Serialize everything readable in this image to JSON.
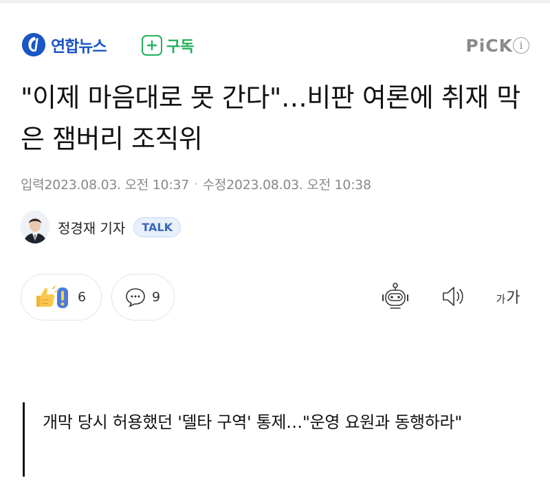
{
  "header": {
    "brand_name": "연합뉴스",
    "subscribe_label": "구독",
    "pick_label": "PiCK",
    "info_glyph": "i",
    "brand_color": "#1a56c4",
    "subscribe_color": "#1fb25a"
  },
  "article": {
    "headline": "\"이제 마음대로 못 간다\"…비판 여론에 취재 막은 잼버리 조직위",
    "input_label": "입력",
    "input_time": "2023.08.03. 오전 10:37",
    "edit_label": "수정",
    "edit_time": "2023.08.03. 오전 10:38",
    "reporter_name": "정경재 기자",
    "talk_label": "TALK"
  },
  "actions": {
    "reaction_count": "6",
    "comment_count": "9",
    "font_small": "가",
    "font_large": "가"
  },
  "icons": {
    "logo": "yonhap-logo-icon",
    "subscribe": "plus-icon",
    "info": "info-icon",
    "reaction": "thumbs-up-exclaim-icon",
    "comment": "speech-bubble-icon",
    "ai_summary": "robot-icon",
    "listen": "speaker-icon",
    "font_size": "font-size-icon"
  },
  "subheading": {
    "text": "개막 당시 허용했던 '델타 구역' 통제…\"운영 요원과 동행하라\""
  }
}
